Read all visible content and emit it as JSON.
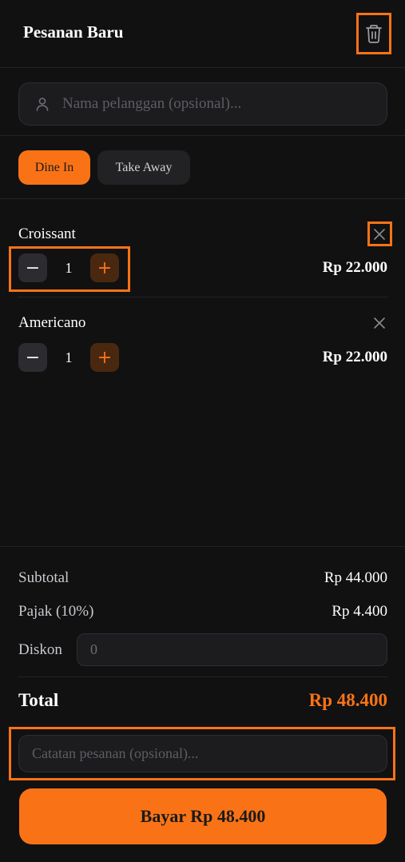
{
  "header": {
    "title": "Pesanan Baru",
    "clear_icon": "trash-icon"
  },
  "customer": {
    "placeholder": "Nama pelanggan (opsional)...",
    "value": "",
    "icon": "user-icon"
  },
  "order_types": [
    {
      "label": "Dine In",
      "active": true
    },
    {
      "label": "Take Away",
      "active": false
    }
  ],
  "items": [
    {
      "name": "Croissant",
      "qty": "1",
      "price": "Rp 22.000"
    },
    {
      "name": "Americano",
      "qty": "1",
      "price": "Rp 22.000"
    }
  ],
  "summary": {
    "subtotal_label": "Subtotal",
    "subtotal_value": "Rp 44.000",
    "tax_label": "Pajak (10%)",
    "tax_value": "Rp 4.400",
    "discount_label": "Diskon",
    "discount_placeholder": "0",
    "total_label": "Total",
    "total_value": "Rp 48.400"
  },
  "note": {
    "placeholder": "Catatan pesanan (opsional)..."
  },
  "pay_button": {
    "label": "Bayar Rp 48.400"
  },
  "colors": {
    "accent": "#f97316",
    "background": "#111112",
    "surface": "#1c1c1f",
    "plus_bg": "#4a2810"
  }
}
